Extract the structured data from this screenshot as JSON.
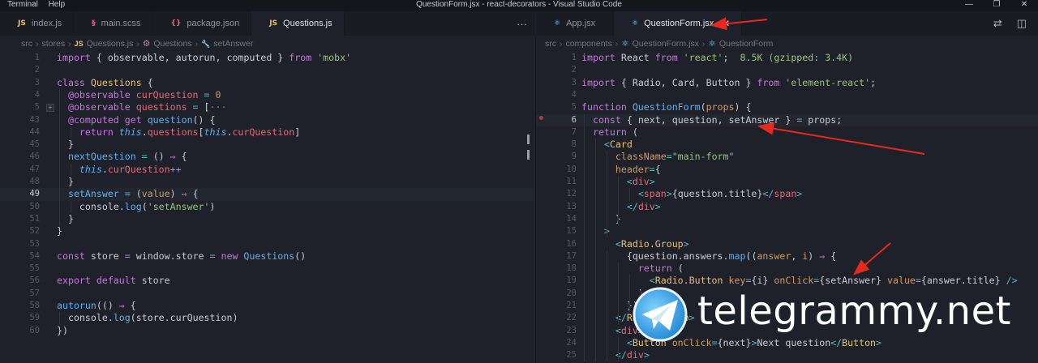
{
  "window": {
    "menu": [
      "Terminal",
      "Help"
    ],
    "title": "QuestionForm.jsx - react-decorators - Visual Studio Code",
    "controls": [
      "—",
      "❐",
      "✕"
    ]
  },
  "left": {
    "tabs": [
      {
        "label": "index.js",
        "icon": "JS",
        "kind": "js",
        "active": false
      },
      {
        "label": "main.scss",
        "icon": "§",
        "kind": "scss",
        "active": false
      },
      {
        "label": "package.json",
        "icon": "{}",
        "kind": "json",
        "active": false
      },
      {
        "label": "Questions.js",
        "icon": "JS",
        "kind": "js",
        "active": true
      }
    ],
    "more": "···",
    "breadcrumb": [
      "src",
      "›",
      "stores",
      "›",
      "JS",
      "Questions.js",
      "›",
      "⚙",
      "Questions",
      "›",
      "🔧",
      "setAnswer"
    ],
    "current_line": "49",
    "lines": [
      {
        "n": "1",
        "t": [
          [
            "k",
            "import "
          ],
          [
            "p",
            "{ "
          ],
          [
            "v",
            "observable"
          ],
          [
            "p",
            ", "
          ],
          [
            "v",
            "autorun"
          ],
          [
            "p",
            ", "
          ],
          [
            "v",
            "computed"
          ],
          [
            "p",
            " } "
          ],
          [
            "k",
            "from "
          ],
          [
            "s",
            "'mobx'"
          ]
        ]
      },
      {
        "n": "2",
        "t": []
      },
      {
        "n": "3",
        "t": [
          [
            "k",
            "class "
          ],
          [
            "c",
            "Questions "
          ],
          [
            "p",
            "{"
          ]
        ]
      },
      {
        "n": "4",
        "t": [
          [
            "p",
            "  "
          ],
          [
            "d",
            "@observable "
          ],
          [
            "t",
            "curQuestion "
          ],
          [
            "o",
            "= "
          ],
          [
            "n",
            "0"
          ]
        ]
      },
      {
        "n": "5",
        "t": [
          [
            "p",
            "  "
          ],
          [
            "d",
            "@observable "
          ],
          [
            "t",
            "questions "
          ],
          [
            "o",
            "= "
          ],
          [
            "p",
            "["
          ],
          [
            "dim",
            "···"
          ]
        ]
      },
      {
        "n": "43",
        "t": [
          [
            "p",
            "  "
          ],
          [
            "d",
            "@computed "
          ],
          [
            "k",
            "get "
          ],
          [
            "f",
            "question"
          ],
          [
            "p",
            "() {"
          ]
        ]
      },
      {
        "n": "44",
        "t": [
          [
            "p",
            "    "
          ],
          [
            "k",
            "return "
          ],
          [
            "it",
            "this"
          ],
          [
            "p",
            "."
          ],
          [
            "t",
            "questions"
          ],
          [
            "p",
            "["
          ],
          [
            "it",
            "this"
          ],
          [
            "p",
            "."
          ],
          [
            "t",
            "curQuestion"
          ],
          [
            "p",
            "]"
          ]
        ]
      },
      {
        "n": "45",
        "t": [
          [
            "p",
            "  }"
          ]
        ]
      },
      {
        "n": "46",
        "t": [
          [
            "p",
            "  "
          ],
          [
            "f",
            "nextQuestion "
          ],
          [
            "o",
            "= "
          ],
          [
            "p",
            "() "
          ],
          [
            "k",
            "⇒ "
          ],
          [
            "p",
            "{"
          ]
        ]
      },
      {
        "n": "47",
        "t": [
          [
            "p",
            "    "
          ],
          [
            "it",
            "this"
          ],
          [
            "p",
            "."
          ],
          [
            "t",
            "curQuestion"
          ],
          [
            "o",
            "++"
          ]
        ]
      },
      {
        "n": "48",
        "t": [
          [
            "p",
            "  }"
          ]
        ]
      },
      {
        "n": "49",
        "t": [
          [
            "p",
            "  "
          ],
          [
            "f",
            "setAnswer "
          ],
          [
            "o",
            "= "
          ],
          [
            "p",
            "("
          ],
          [
            "a",
            "value"
          ],
          [
            "p",
            ") "
          ],
          [
            "k",
            "⇒ "
          ],
          [
            "p",
            "{"
          ]
        ]
      },
      {
        "n": "50",
        "t": [
          [
            "p",
            "    "
          ],
          [
            "v",
            "console"
          ],
          [
            "p",
            "."
          ],
          [
            "f",
            "log"
          ],
          [
            "p",
            "("
          ],
          [
            "s",
            "'setAnswer'"
          ],
          [
            "p",
            ")"
          ]
        ]
      },
      {
        "n": "51",
        "t": [
          [
            "p",
            "  }"
          ]
        ]
      },
      {
        "n": "52",
        "t": [
          [
            "p",
            "}"
          ]
        ]
      },
      {
        "n": "53",
        "t": []
      },
      {
        "n": "54",
        "t": [
          [
            "k",
            "const "
          ],
          [
            "v",
            "store "
          ],
          [
            "o",
            "= "
          ],
          [
            "v",
            "window"
          ],
          [
            "p",
            "."
          ],
          [
            "v",
            "store "
          ],
          [
            "o",
            "= "
          ],
          [
            "k",
            "new "
          ],
          [
            "f",
            "Questions"
          ],
          [
            "p",
            "()"
          ]
        ]
      },
      {
        "n": "55",
        "t": []
      },
      {
        "n": "56",
        "t": [
          [
            "k",
            "export default "
          ],
          [
            "v",
            "store"
          ]
        ]
      },
      {
        "n": "57",
        "t": []
      },
      {
        "n": "58",
        "t": [
          [
            "f",
            "autorun"
          ],
          [
            "p",
            "(() "
          ],
          [
            "k",
            "⇒ "
          ],
          [
            "p",
            "{"
          ]
        ]
      },
      {
        "n": "59",
        "t": [
          [
            "p",
            "  "
          ],
          [
            "v",
            "console"
          ],
          [
            "p",
            "."
          ],
          [
            "f",
            "log"
          ],
          [
            "p",
            "("
          ],
          [
            "v",
            "store"
          ],
          [
            "p",
            "."
          ],
          [
            "v",
            "curQuestion"
          ],
          [
            "p",
            ")"
          ]
        ]
      },
      {
        "n": "60",
        "t": [
          [
            "p",
            "})"
          ]
        ]
      }
    ]
  },
  "right": {
    "tabs": [
      {
        "label": "App.jsx",
        "icon": "⚛",
        "kind": "react",
        "active": false
      },
      {
        "label": "QuestionForm.jsx",
        "icon": "⚛",
        "kind": "react",
        "active": true
      }
    ],
    "actions": [
      "⇄",
      "◫"
    ],
    "breadcrumb": [
      "src",
      "›",
      "components",
      "›",
      "⚛",
      "QuestionForm.jsx",
      "›",
      "⚛",
      "QuestionForm"
    ],
    "current_line": "6",
    "lines": [
      {
        "n": "1",
        "t": [
          [
            "k",
            "import "
          ],
          [
            "v",
            "React "
          ],
          [
            "k",
            "from "
          ],
          [
            "s",
            "'react'"
          ],
          [
            "p",
            ";  "
          ],
          [
            "mut",
            "8.5K (gzipped: 3.4K)"
          ]
        ]
      },
      {
        "n": "2",
        "t": []
      },
      {
        "n": "3",
        "t": [
          [
            "k",
            "import "
          ],
          [
            "p",
            "{ "
          ],
          [
            "v",
            "Radio"
          ],
          [
            "p",
            ", "
          ],
          [
            "v",
            "Card"
          ],
          [
            "p",
            ", "
          ],
          [
            "v",
            "Button "
          ],
          [
            "p",
            "} "
          ],
          [
            "k",
            "from "
          ],
          [
            "s",
            "'element-react'"
          ],
          [
            "p",
            ";"
          ]
        ]
      },
      {
        "n": "4",
        "t": []
      },
      {
        "n": "5",
        "t": [
          [
            "k",
            "function "
          ],
          [
            "f",
            "QuestionForm"
          ],
          [
            "p",
            "("
          ],
          [
            "a",
            "props"
          ],
          [
            "p",
            ") {"
          ]
        ]
      },
      {
        "n": "6",
        "t": [
          [
            "p",
            "  "
          ],
          [
            "k",
            "const "
          ],
          [
            "p",
            "{ "
          ],
          [
            "v",
            "next"
          ],
          [
            "p",
            ", "
          ],
          [
            "v",
            "question"
          ],
          [
            "p",
            ", "
          ],
          [
            "v",
            "setAnswer "
          ],
          [
            "p",
            "} "
          ],
          [
            "o",
            "= "
          ],
          [
            "v",
            "props"
          ],
          [
            "p",
            ";"
          ]
        ]
      },
      {
        "n": "7",
        "t": [
          [
            "p",
            "  "
          ],
          [
            "k",
            "return "
          ],
          [
            "p",
            "("
          ]
        ]
      },
      {
        "n": "8",
        "t": [
          [
            "p",
            "    "
          ],
          [
            "o",
            "<"
          ],
          [
            "c",
            "Card"
          ]
        ]
      },
      {
        "n": "9",
        "t": [
          [
            "p",
            "      "
          ],
          [
            "a",
            "className"
          ],
          [
            "o",
            "="
          ],
          [
            "s",
            "\"main-form\""
          ]
        ]
      },
      {
        "n": "10",
        "t": [
          [
            "p",
            "      "
          ],
          [
            "a",
            "header"
          ],
          [
            "o",
            "="
          ],
          [
            "p",
            "{"
          ]
        ]
      },
      {
        "n": "11",
        "t": [
          [
            "p",
            "        "
          ],
          [
            "o",
            "<"
          ],
          [
            "t",
            "div"
          ],
          [
            "o",
            ">"
          ]
        ]
      },
      {
        "n": "12",
        "t": [
          [
            "p",
            "          "
          ],
          [
            "o",
            "<"
          ],
          [
            "t",
            "span"
          ],
          [
            "o",
            ">"
          ],
          [
            "p",
            "{"
          ],
          [
            "v",
            "question"
          ],
          [
            "p",
            "."
          ],
          [
            "v",
            "title"
          ],
          [
            "p",
            "}"
          ],
          [
            "o",
            "</"
          ],
          [
            "t",
            "span"
          ],
          [
            "o",
            ">"
          ]
        ]
      },
      {
        "n": "13",
        "t": [
          [
            "p",
            "        "
          ],
          [
            "o",
            "</"
          ],
          [
            "t",
            "div"
          ],
          [
            "o",
            ">"
          ]
        ]
      },
      {
        "n": "14",
        "t": [
          [
            "p",
            "      }"
          ]
        ]
      },
      {
        "n": "15",
        "t": [
          [
            "p",
            "    "
          ],
          [
            "o",
            ">"
          ]
        ]
      },
      {
        "n": "16",
        "t": [
          [
            "p",
            "      "
          ],
          [
            "o",
            "<"
          ],
          [
            "c",
            "Radio.Group"
          ],
          [
            "o",
            ">"
          ]
        ]
      },
      {
        "n": "17",
        "t": [
          [
            "p",
            "        {"
          ],
          [
            "v",
            "question"
          ],
          [
            "p",
            "."
          ],
          [
            "v",
            "answers"
          ],
          [
            "p",
            "."
          ],
          [
            "f",
            "map"
          ],
          [
            "p",
            "(("
          ],
          [
            "a",
            "answer"
          ],
          [
            "p",
            ", "
          ],
          [
            "a",
            "i"
          ],
          [
            "p",
            ") "
          ],
          [
            "k",
            "⇒ "
          ],
          [
            "p",
            "{"
          ]
        ]
      },
      {
        "n": "18",
        "t": [
          [
            "p",
            "          "
          ],
          [
            "k",
            "return "
          ],
          [
            "p",
            "("
          ]
        ]
      },
      {
        "n": "19",
        "t": [
          [
            "p",
            "            "
          ],
          [
            "o",
            "<"
          ],
          [
            "c",
            "Radio.Button "
          ],
          [
            "a",
            "key"
          ],
          [
            "o",
            "="
          ],
          [
            "p",
            "{"
          ],
          [
            "v",
            "i"
          ],
          [
            "p",
            "} "
          ],
          [
            "a",
            "onClick"
          ],
          [
            "o",
            "="
          ],
          [
            "p",
            "{"
          ],
          [
            "v",
            "setAnswer"
          ],
          [
            "p",
            "} "
          ],
          [
            "a",
            "value"
          ],
          [
            "o",
            "="
          ],
          [
            "p",
            "{"
          ],
          [
            "v",
            "answer"
          ],
          [
            "p",
            "."
          ],
          [
            "v",
            "title"
          ],
          [
            "p",
            "} "
          ],
          [
            "o",
            "/>"
          ]
        ]
      },
      {
        "n": "20",
        "t": [
          [
            "p",
            "          )"
          ]
        ]
      },
      {
        "n": "21",
        "t": [
          [
            "p",
            "        })"
          ]
        ]
      },
      {
        "n": "22",
        "t": [
          [
            "p",
            "      "
          ],
          [
            "o",
            "</"
          ],
          [
            "c",
            "Radio.Group"
          ],
          [
            "o",
            ">"
          ]
        ]
      },
      {
        "n": "23",
        "t": [
          [
            "p",
            "      "
          ],
          [
            "o",
            "<"
          ],
          [
            "t",
            "div"
          ],
          [
            "o",
            ">"
          ]
        ]
      },
      {
        "n": "24",
        "t": [
          [
            "p",
            "        "
          ],
          [
            "o",
            "<"
          ],
          [
            "c",
            "Button "
          ],
          [
            "a",
            "onClick"
          ],
          [
            "o",
            "="
          ],
          [
            "p",
            "{"
          ],
          [
            "v",
            "next"
          ],
          [
            "p",
            "}"
          ],
          [
            "o",
            ">"
          ],
          [
            "p",
            "Next question"
          ],
          [
            "o",
            "</"
          ],
          [
            "c",
            "Button"
          ],
          [
            "o",
            ">"
          ]
        ]
      },
      {
        "n": "25",
        "t": [
          [
            "p",
            "      "
          ],
          [
            "o",
            "</"
          ],
          [
            "t",
            "div"
          ],
          [
            "o",
            ">"
          ]
        ]
      }
    ]
  },
  "watermark": {
    "text": "telegrammy.net",
    "icon": "paper-plane-icon"
  },
  "colors": {
    "annotation_arrow": "#e8281f",
    "background": "#1e2129",
    "accent": "#61afef"
  }
}
